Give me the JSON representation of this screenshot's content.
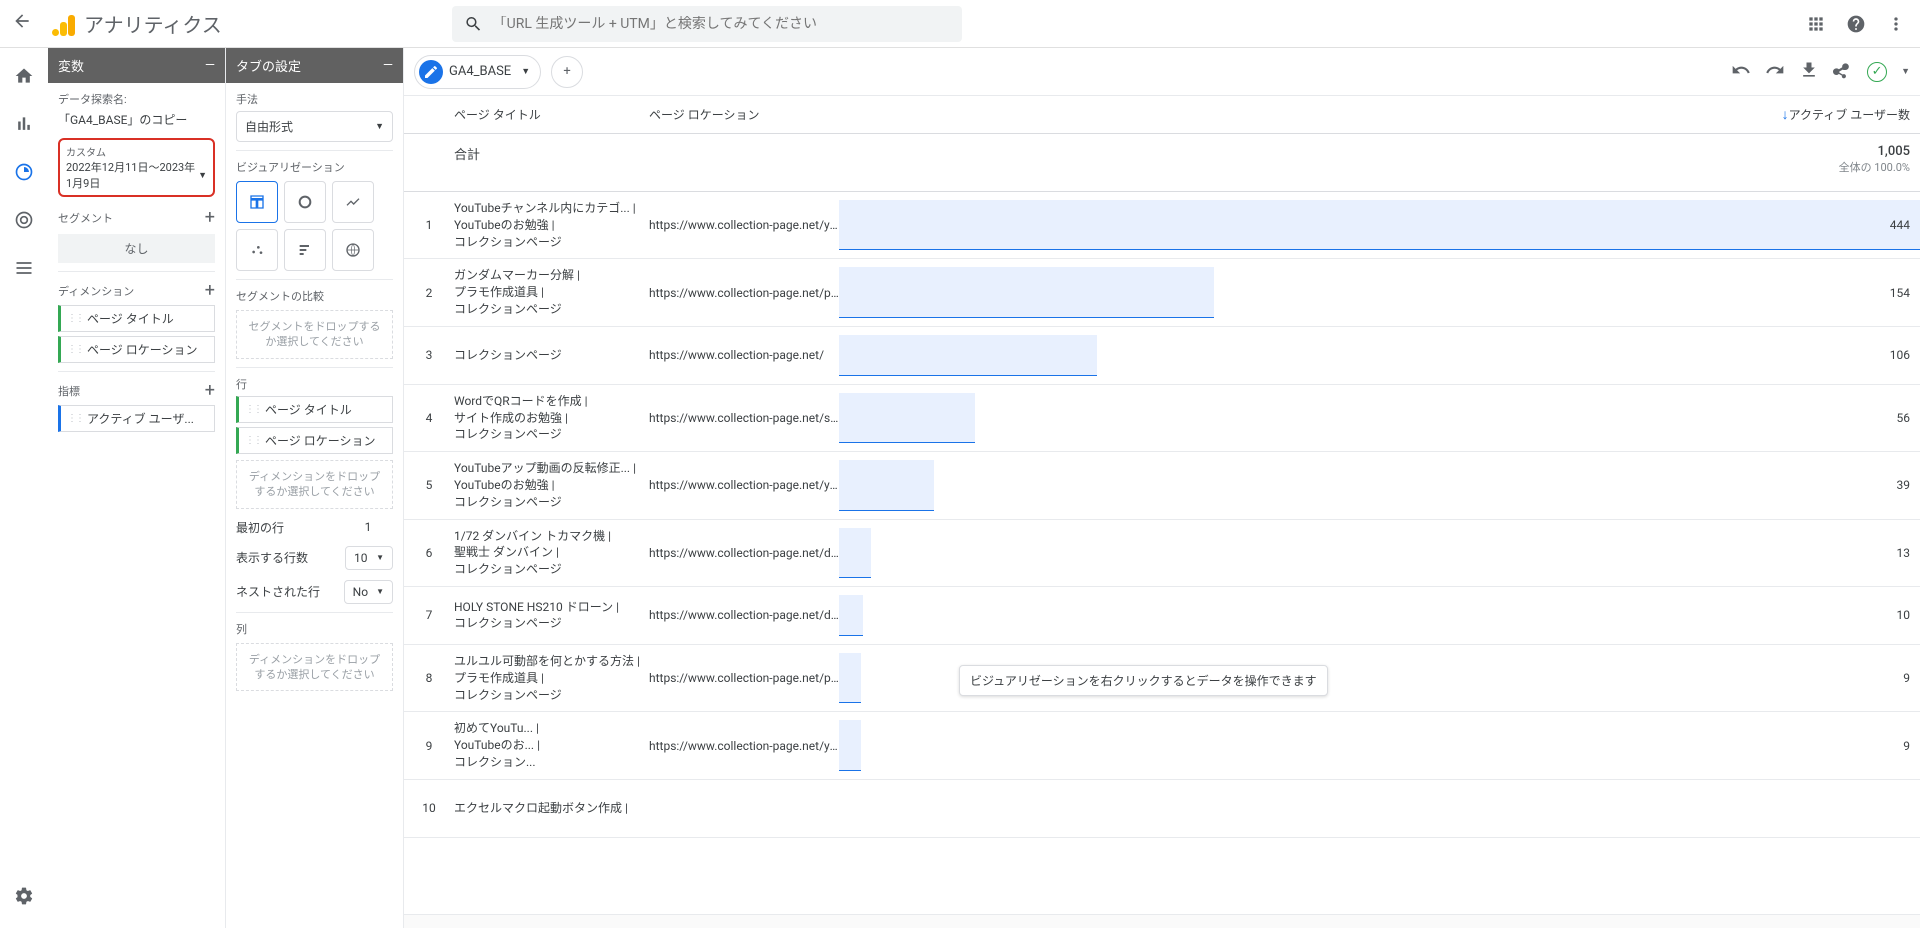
{
  "app": {
    "title": "アナリティクス"
  },
  "search": {
    "placeholder": "「URL 生成ツール + UTM」と検索してみてください"
  },
  "vars_panel": {
    "header": "変数",
    "exploration_label": "データ探索名:",
    "exploration_name": "「GA4_BASE」のコピー",
    "date_label": "カスタム",
    "date_value": "2022年12月11日～2023年1月9日",
    "segments_label": "セグメント",
    "segments_none": "なし",
    "dimensions_label": "ディメンション",
    "dim1": "ページ タイトル",
    "dim2": "ページ ロケーション",
    "metrics_label": "指標",
    "metric1": "アクティブ ユーザ..."
  },
  "tab_panel": {
    "header": "タブの設定",
    "technique_label": "手法",
    "technique_value": "自由形式",
    "viz_label": "ビジュアリゼーション",
    "seg_compare_label": "セグメントの比較",
    "seg_drop": "セグメントをドロップするか選択してください",
    "rows_label": "行",
    "row_dim1": "ページ タイトル",
    "row_dim2": "ページ ロケーション",
    "dim_drop": "ディメンションをドロップするか選択してください",
    "first_row_label": "最初の行",
    "first_row_value": "1",
    "show_rows_label": "表示する行数",
    "show_rows_value": "10",
    "nested_label": "ネストされた行",
    "nested_value": "No",
    "cols_label": "列",
    "col_drop": "ディメンションをドロップするか選択してください"
  },
  "canvas": {
    "tab_name": "GA4_BASE",
    "col_title": "ページ タイトル",
    "col_location": "ページ ロケーション",
    "metric_name": "アクティブ ユーザー数",
    "total_label": "合計",
    "total_value": "1,005",
    "total_pct": "全体の 100.0%",
    "tooltip": "ビジュアリゼーションを右クリックするとデータを操作できます"
  },
  "chart_data": {
    "type": "bar",
    "metric": "アクティブ ユーザー数",
    "total": 1005,
    "rows": [
      {
        "idx": 1,
        "title": "YouTubeチャンネル内にカテゴ... | YouTubeのお勉強 | コレクションページ",
        "location": "https://www.collection-page.net/yo...",
        "value": 444
      },
      {
        "idx": 2,
        "title": "ガンダムマーカー分解 | プラモ作成道具 | コレクションページ",
        "location": "https://www.collection-page.net/pla...",
        "value": 154
      },
      {
        "idx": 3,
        "title": "コレクションページ",
        "location": "https://www.collection-page.net/",
        "value": 106
      },
      {
        "idx": 4,
        "title": "WordでQRコードを作成 | サイト作成のお勉強 | コレクションページ",
        "location": "https://www.collection-page.net/st...",
        "value": 56
      },
      {
        "idx": 5,
        "title": "YouTubeアップ動画の反転修正... | YouTubeのお勉強 | コレクションページ",
        "location": "https://www.collection-page.net/you...",
        "value": 39
      },
      {
        "idx": 6,
        "title": "1/72 ダンバイン トカマク機 | 聖戦士 ダンバイン | コレクションページ",
        "location": "https://www.collection-page.net/du...",
        "value": 13
      },
      {
        "idx": 7,
        "title": "HOLY STONE HS210 ドローン | コレクションページ",
        "location": "https://www.collection-page.net/dro...",
        "value": 10
      },
      {
        "idx": 8,
        "title": "ユルユル可動部を何とかする方法 | プラモ作成道具 | コレクションページ",
        "location": "https://www.collection-page.net/pla...",
        "value": 9
      },
      {
        "idx": 9,
        "title": "初めてYouTu... | YouTubeのお... | コレクション...",
        "location": "https://www.collection-page.net/yo...",
        "value": 9
      },
      {
        "idx": 10,
        "title": "エクセルマクロ起動ボタン作成 |",
        "location": "",
        "value": 0
      }
    ]
  }
}
